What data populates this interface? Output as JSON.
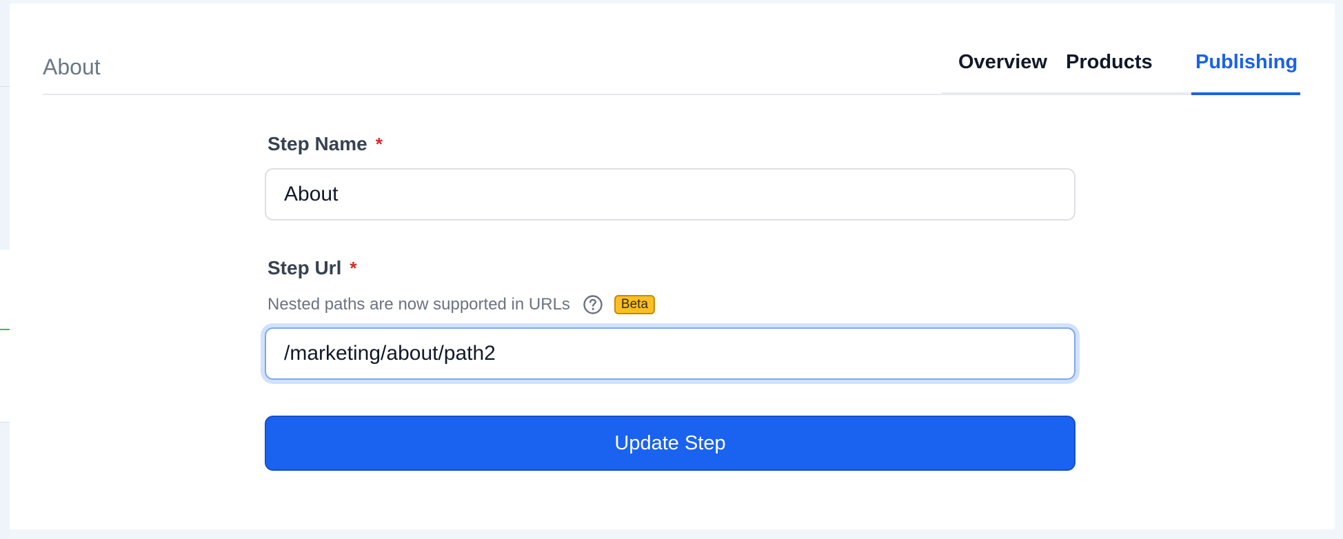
{
  "header": {
    "title": "About"
  },
  "tabs": [
    {
      "label": "Overview",
      "active": false
    },
    {
      "label": "Products",
      "active": false
    },
    {
      "label": "Publishing",
      "active": true
    }
  ],
  "form": {
    "step_name": {
      "label": "Step Name",
      "required_mark": "*",
      "value": "About"
    },
    "step_url": {
      "label": "Step Url",
      "required_mark": "*",
      "helper_text": "Nested paths are now supported in URLs",
      "help_icon": "question-circle-icon",
      "badge": "Beta",
      "value": "/marketing/about/path2"
    },
    "submit_label": "Update Step"
  },
  "colors": {
    "accent": "#1a62e8",
    "button": "#1a62f0",
    "required": "#dc2626",
    "badge": "#fbbf24"
  }
}
